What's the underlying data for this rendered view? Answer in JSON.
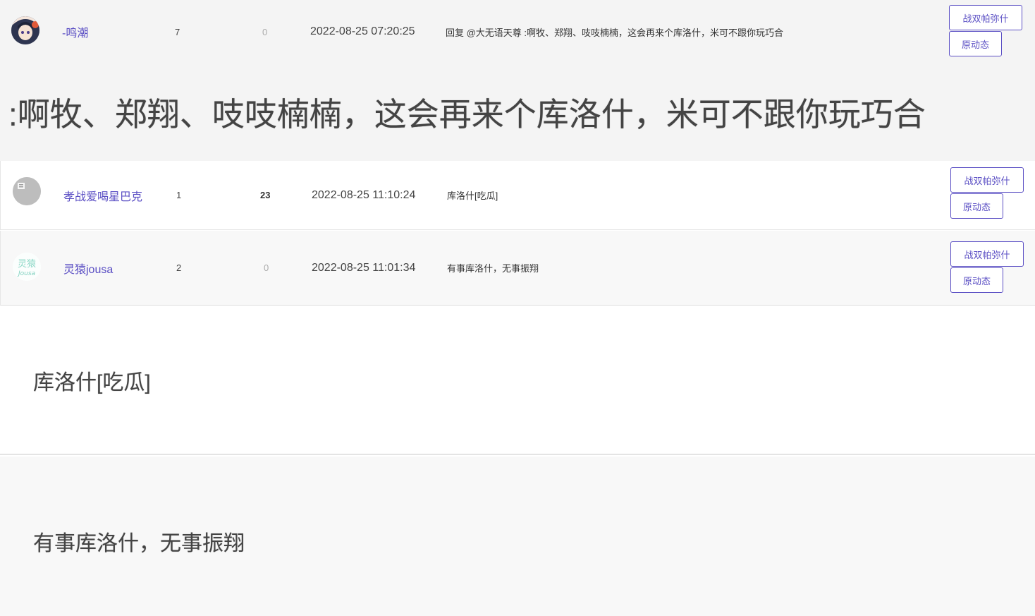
{
  "rows": [
    {
      "username": "-鸣潮",
      "count_a": "7",
      "count_b": "0",
      "time": "2022-08-25 07:20:25",
      "content": "回复 @大无语天尊 :啊牧、郑翔、吱吱楠楠，这会再来个库洛什，米可不跟你玩巧合",
      "btn_primary": "战双帕弥什",
      "btn_secondary": "原动态"
    },
    {
      "username": "孝战爱喝星巴克",
      "count_a": "1",
      "count_b": "23",
      "time": "2022-08-25 11:10:24",
      "content": "库洛什[吃瓜]",
      "btn_primary": "战双帕弥什",
      "btn_secondary": "原动态"
    },
    {
      "username": "灵猿jousa",
      "count_a": "2",
      "count_b": "0",
      "time": "2022-08-25 11:01:34",
      "content": "有事库洛什，无事振翔",
      "btn_primary": "战双帕弥什",
      "btn_secondary": "原动态"
    }
  ],
  "expanded": {
    "text_1": ":啊牧、郑翔、吱吱楠楠，这会再来个库洛什，米可不跟你玩巧合",
    "text_2": "库洛什[吃瓜]",
    "text_3": "有事库洛什，无事振翔"
  },
  "colors": {
    "accent": "#5b4fc4",
    "row_gray": "#f4f4f4",
    "row_white": "#ffffff"
  }
}
